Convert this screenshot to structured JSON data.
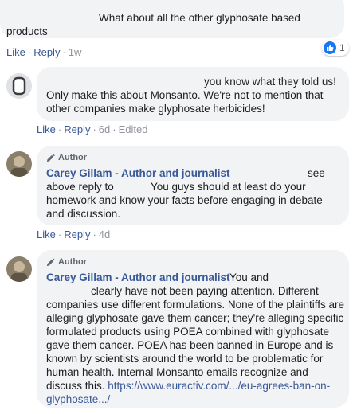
{
  "comments": [
    {
      "text_line1": "What about all the other glyphosate based",
      "text_line2": "products",
      "actions": {
        "like": "Like",
        "reply": "Reply",
        "time": "1w"
      },
      "reaction_count": "1"
    },
    {
      "text_first": "you know what they told us!",
      "text_rest": "Only make this about Monsanto. We're not to mention that other companies make glyphosate herbicides!",
      "actions": {
        "like": "Like",
        "reply": "Reply",
        "time": "6d",
        "edited": "Edited"
      }
    },
    {
      "author_badge": "Author",
      "name": "Carey Gillam - Author and journalist",
      "text_a": "see",
      "text_b": "above reply to",
      "text_c": "You guys should at least do your homework and know your facts before engaging in debate and discussion.",
      "actions": {
        "like": "Like",
        "reply": "Reply",
        "time": "4d"
      }
    },
    {
      "author_badge": "Author",
      "name": "Carey Gillam - Author and journalist",
      "text_a": "You and",
      "text_b": "clearly have not been paying attention. Different companies use different formulations. None of the plaintiffs are alleging glyphosate gave them cancer; they're alleging specific formulated products using POEA combined with glyphosate gave them cancer. POEA has been banned in Europe and is known by scientists around the world to be problematic for human health. Internal Monsanto emails recognize and discuss this.",
      "link": "https://www.euractiv.com/.../eu-agrees-ban-on-glyphosate.../"
    }
  ],
  "sep": "·"
}
